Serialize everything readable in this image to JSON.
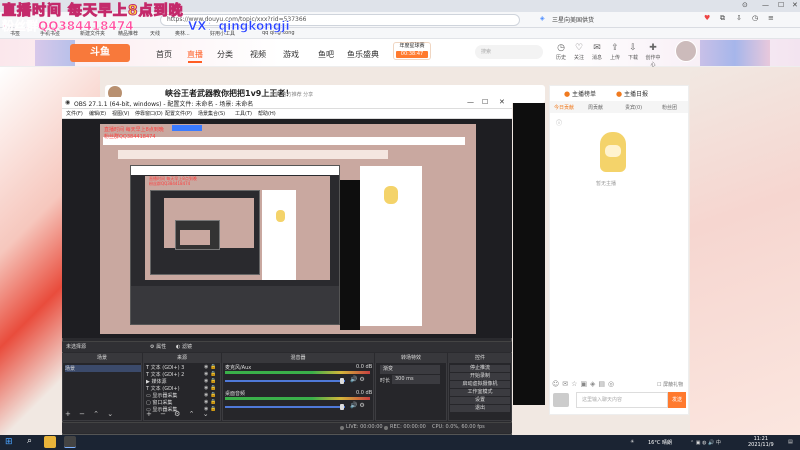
{
  "browser": {
    "tab_title": "斗鱼",
    "url": "https://www.douyu.com/topic/xxx?rid=537366",
    "search_box": "三星向美国供货",
    "profile": "",
    "bookmarks": [
      "书签",
      "手机书签",
      "新建文件夹",
      "精品推荐",
      "天线",
      "奥林...",
      "好用小工具",
      "qq qing kong"
    ]
  },
  "overlays": {
    "line1": "直播时间 每天早上8点到晚",
    "line2": "粉丝群QQ384418474",
    "line3": "VX：qingkongji"
  },
  "site": {
    "logo": "斗鱼",
    "nav": [
      "首页",
      "直播",
      "分类",
      "视频",
      "游戏",
      "鱼吧",
      "鱼乐盛典"
    ],
    "nav_active": "直播",
    "new_badge_title": "年度星球赛",
    "new_badge_time": "00:38:47",
    "search_placeholder": "搜索",
    "header_icons": [
      {
        "name": "history-icon",
        "glyph": "◷",
        "label": "历史"
      },
      {
        "name": "follow-icon",
        "glyph": "♡",
        "label": "关注"
      },
      {
        "name": "message-icon",
        "glyph": "✉",
        "label": "消息"
      },
      {
        "name": "upload-icon",
        "glyph": "⇪",
        "label": "上传"
      },
      {
        "name": "download-icon",
        "glyph": "⇩",
        "label": "下载"
      },
      {
        "name": "create-icon",
        "glyph": "✚",
        "label": "创作中心"
      }
    ]
  },
  "room": {
    "title": "峡谷王者武器教你把把1v9上王者！",
    "subtitle": "举报   官方推荐   分享"
  },
  "chat": {
    "tabs": [
      "主播榜单",
      "主播日报"
    ],
    "subtabs": [
      "今日贡献",
      "周贡献",
      "贵宾(0)",
      "粉丝团"
    ],
    "subtab_active": "今日贡献",
    "mascot_caption": "暂无主播",
    "input_placeholder": "这里输入聊天内容",
    "send": "发送",
    "checkbox": "屏蔽礼物"
  },
  "obs": {
    "title": "OBS 27.1.1 (64-bit, windows) - 配置文件: 未命名 - 场景: 未命名",
    "menu": [
      "文件(F)",
      "编辑(E)",
      "视图(V)",
      "停靠窗口(D)",
      "配置文件(P)",
      "场景集合(S)",
      "工具(T)",
      "帮助(H)"
    ],
    "preview_overlay_a": "直播时间 每天早上8点到晚",
    "preview_overlay_b": "粉丝群QQ384418474",
    "no_source_selected": "未选择源",
    "props_btn": "属性",
    "filter_btn": "滤镜",
    "scenes_title": "场景",
    "scenes": [
      "场景"
    ],
    "sources_title": "来源",
    "sources": [
      "文本 (GDI+) 3",
      "文本 (GDI+) 2",
      "媒体源",
      "文本 (GDI+)",
      "显示器采集",
      "窗口采集",
      "显示器采集"
    ],
    "mixer_title": "混音器",
    "mixer": [
      {
        "name": "桌面音频",
        "db": "0.0 dB"
      },
      {
        "name": "麦克风/Aux",
        "db": "0.0 dB"
      }
    ],
    "transitions_title": "转场特效",
    "transition_type": "渐变",
    "duration_label": "时长",
    "duration": "300 ms",
    "controls_title": "控件",
    "controls": [
      "停止推流",
      "开始录制",
      "启动虚拟摄像机",
      "工作室模式",
      "设置",
      "退出"
    ],
    "status": {
      "live": "LIVE: 00:00:00",
      "rec": "REC: 00:00:00",
      "cpu": "CPU: 0.0%, 60.00 fps"
    }
  },
  "taskbar": {
    "weather_temp": "16°C",
    "weather_desc": "晴朗",
    "time": "11:21",
    "date": "2021/11/9"
  }
}
